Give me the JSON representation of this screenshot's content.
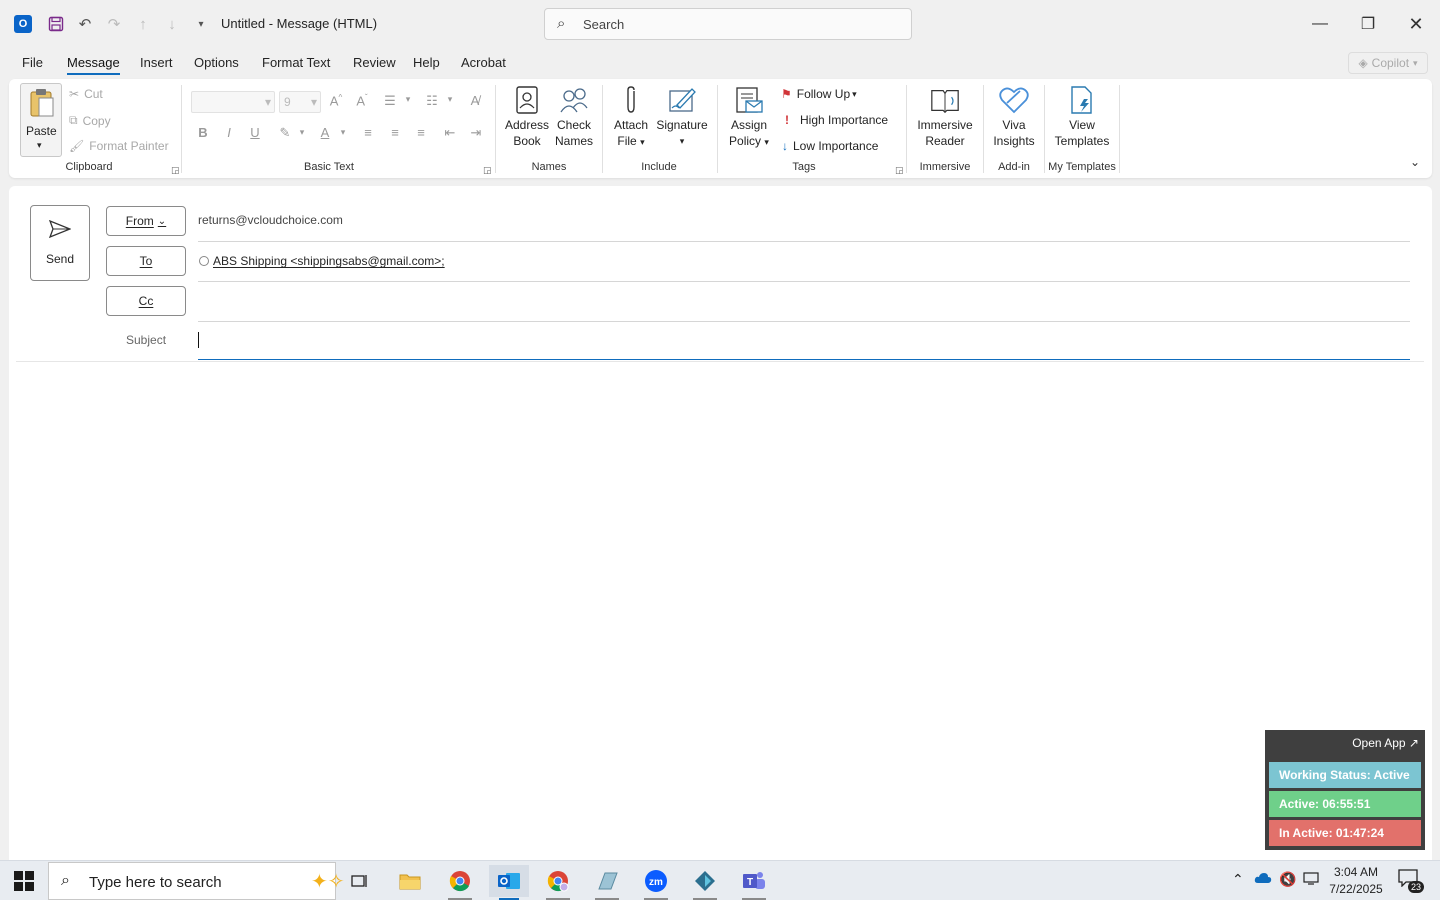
{
  "window": {
    "title": "Untitled  -  Message (HTML)",
    "search_placeholder": "Search"
  },
  "menu_tabs": [
    "File",
    "Message",
    "Insert",
    "Options",
    "Format Text",
    "Review",
    "Help",
    "Acrobat"
  ],
  "copilot_label": "Copilot",
  "ribbon": {
    "clipboard": {
      "paste": "Paste",
      "cut": "Cut",
      "copy": "Copy",
      "format_painter": "Format Painter",
      "label": "Clipboard"
    },
    "basic_text": {
      "font_size": "9",
      "label": "Basic Text"
    },
    "names": {
      "address_book_1": "Address",
      "address_book_2": "Book",
      "check_names_1": "Check",
      "check_names_2": "Names",
      "label": "Names"
    },
    "include": {
      "attach_1": "Attach",
      "attach_2": "File",
      "signature": "Signature",
      "label": "Include"
    },
    "tags": {
      "assign_1": "Assign",
      "assign_2": "Policy",
      "follow_up": "Follow Up",
      "high": "High Importance",
      "low": "Low Importance",
      "label": "Tags"
    },
    "immersive": {
      "btn_1": "Immersive",
      "btn_2": "Reader",
      "label": "Immersive"
    },
    "addin": {
      "btn_1": "Viva",
      "btn_2": "Insights",
      "label": "Add-in"
    },
    "templates": {
      "btn_1": "View",
      "btn_2": "Templates",
      "label": "My Templates"
    }
  },
  "compose": {
    "send": "Send",
    "from_label": "From",
    "from_value": "returns@vcloudchoice.com",
    "to_label": "To",
    "to_recipient": "ABS Shipping <shippingsabs@gmail.com>;",
    "cc_label": "Cc",
    "subject_label": "Subject",
    "subject_value": ""
  },
  "widget": {
    "open_app": "Open App ↗",
    "working_status": "Working Status: Active",
    "active": "Active: 06:55:51",
    "inactive": "In Active: 01:47:24",
    "colors": {
      "working": "#7cc5d2",
      "active": "#6fd08a",
      "inactive": "#e2716b"
    }
  },
  "taskbar": {
    "search_placeholder": "Type here to search",
    "time": "3:04 AM",
    "date": "7/22/2025",
    "notification_count": "23"
  }
}
